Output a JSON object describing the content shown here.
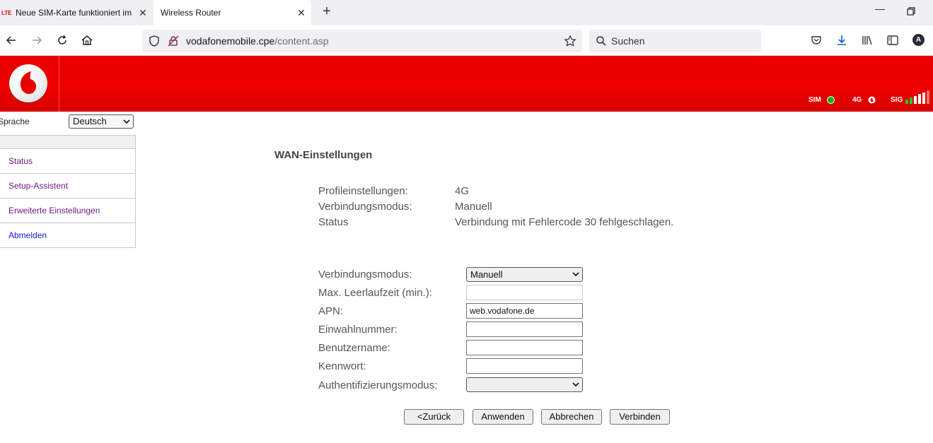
{
  "browser": {
    "tabs": [
      {
        "favicon": "LTE",
        "title": "Neue SIM-Karte funktioniert im"
      },
      {
        "title": "Wireless Router"
      }
    ],
    "url": {
      "host": "vodafonemobile.cpe",
      "path": "/content.asp"
    },
    "search_placeholder": "Suchen",
    "profile_initial": "A"
  },
  "header": {
    "indicators": {
      "sim": {
        "label": "SIM",
        "status_color": "#22aa22"
      },
      "net": {
        "label": "4G",
        "status_color": "#ffffff"
      },
      "sig": {
        "label": "SIG",
        "level": 5,
        "max": 6
      }
    }
  },
  "sidebar": {
    "language_label": "Sprache",
    "language_value": "Deutsch",
    "items": [
      {
        "label": "Status"
      },
      {
        "label": "Setup-Assistent"
      },
      {
        "label": "Erweiterte Einstellungen"
      },
      {
        "label": "Abmelden"
      }
    ]
  },
  "main": {
    "title": "WAN-Einstellungen",
    "info": [
      {
        "label": "Profileinstellungen:",
        "value": "4G"
      },
      {
        "label": "Verbindungsmodus:",
        "value": "Manuell"
      },
      {
        "label": "Status",
        "value": "Verbindung mit Fehlercode 30 fehlgeschlagen."
      }
    ],
    "form": {
      "mode_label": "Verbindungsmodus:",
      "mode_value": "Manuell",
      "idle_label": "Max. Leerlaufzeit (min.):",
      "idle_value": "",
      "apn_label": "APN:",
      "apn_value": "web.vodafone.de",
      "dial_label": "Einwahlnummer:",
      "dial_value": "",
      "user_label": "Benutzername:",
      "user_value": "",
      "pass_label": "Kennwort:",
      "pass_value": "",
      "auth_label": "Authentifizierungsmodus:",
      "auth_value": ""
    },
    "buttons": {
      "back": "<Zurück",
      "apply": "Anwenden",
      "cancel": "Abbrechen",
      "connect": "Verbinden"
    }
  },
  "colors": {
    "brand_red": "#e60000",
    "visited_link": "#6a1b7a",
    "link": "#1a1ad2"
  }
}
